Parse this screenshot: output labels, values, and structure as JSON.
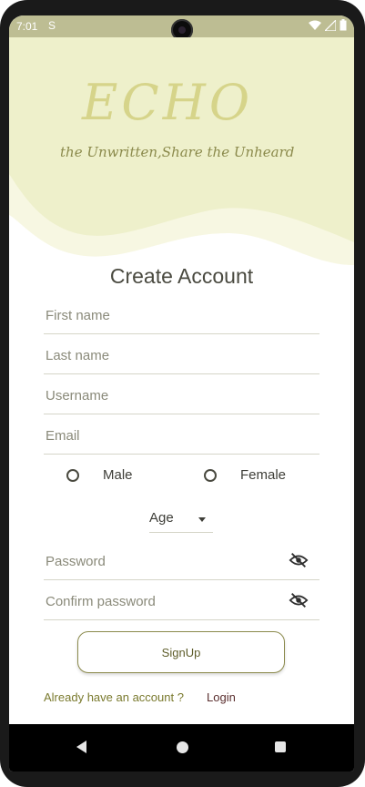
{
  "status": {
    "time": "7:01",
    "sim_icon": "S"
  },
  "brand": {
    "logo": "ECHO",
    "tagline": "the Unwritten,Share the Unheard"
  },
  "form": {
    "title": "Create Account",
    "first_name_placeholder": "First name",
    "last_name_placeholder": "Last name",
    "username_placeholder": "Username",
    "email_placeholder": "Email",
    "gender": {
      "male_label": "Male",
      "female_label": "Female"
    },
    "age_label": "Age",
    "password_placeholder": "Password",
    "confirm_password_placeholder": "Confirm password",
    "signup_label": "SignUp",
    "footer_question": "Already have an account ?",
    "footer_link": "Login"
  },
  "colors": {
    "accent_olive": "#8b8a4c",
    "hero_cream": "#f1f1cf",
    "statusbar": "#bdbd93"
  },
  "icons": [
    "wifi-icon",
    "signal-icon",
    "battery-icon",
    "eye-off-icon",
    "dropdown-caret-icon",
    "back-icon",
    "home-icon",
    "recents-icon"
  ]
}
